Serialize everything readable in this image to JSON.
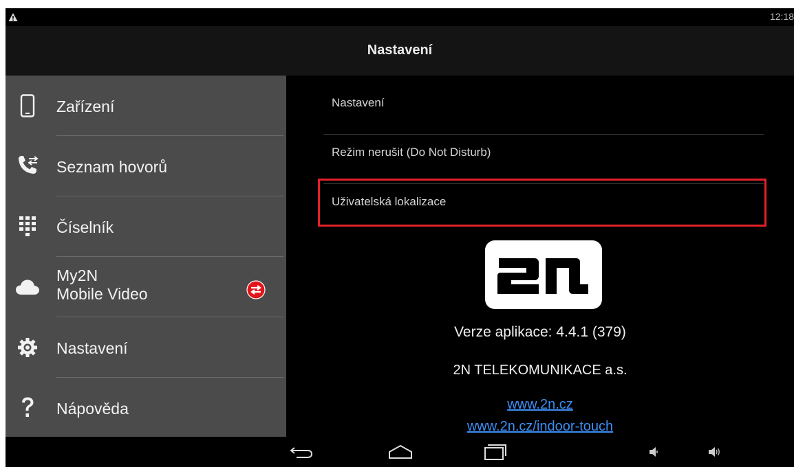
{
  "status_bar": {
    "time": "12:18",
    "warning_icon": "warning-triangle-icon"
  },
  "header": {
    "title": "Nastavení"
  },
  "sidebar": {
    "items": [
      {
        "label": "Zařízení",
        "icon": "device-phone-icon"
      },
      {
        "label": "Seznam hovorů",
        "icon": "call-log-icon"
      },
      {
        "label_line1": "Číselník",
        "icon": "dialpad-icon"
      },
      {
        "label_line1": "My2N",
        "label_line2": "Mobile Video",
        "icon": "cloud-icon",
        "badge_icon": "sync-badge-icon"
      },
      {
        "label": "Nastavení",
        "icon": "gear-icon"
      },
      {
        "label": "Nápověda",
        "icon": "help-icon"
      }
    ]
  },
  "settings_list": {
    "items": [
      {
        "label": "Nastavení"
      },
      {
        "label": "Režim nerušit (Do Not Disturb)"
      },
      {
        "label": "Uživatelská lokalizace",
        "highlighted": true
      }
    ]
  },
  "about": {
    "logo_text": "2N",
    "version": "Verze aplikace: 4.4.1 (379)",
    "company": "2N TELEKOMUNIKACE a.s.",
    "links": [
      "www.2n.cz",
      "www.2n.cz/indoor-touch"
    ]
  },
  "navbar": {
    "buttons": [
      "back-icon",
      "home-icon",
      "recents-icon",
      "volume-down-icon",
      "volume-up-icon"
    ]
  },
  "colors": {
    "highlight": "#e32129",
    "link": "#3d8ef5",
    "sidebar_bg": "#4b4b4b",
    "header_bg": "#141414"
  }
}
